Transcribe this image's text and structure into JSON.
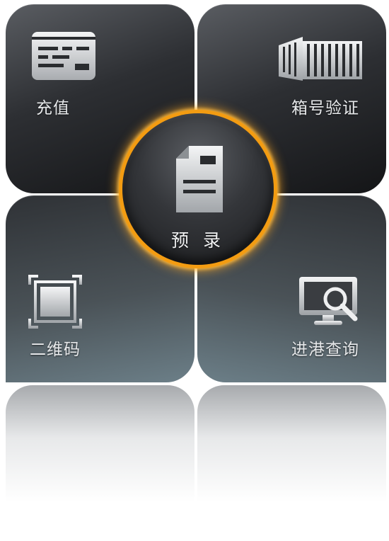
{
  "tiles": {
    "recharge": {
      "label": "充值",
      "icon": "card-icon"
    },
    "container_verify": {
      "label": "箱号验证",
      "icon": "container-icon"
    },
    "qr_code": {
      "label": "二维码",
      "icon": "qr-frame-icon"
    },
    "port_entry_query": {
      "label": "进港查询",
      "icon": "monitor-search-icon"
    }
  },
  "center": {
    "label": "预 录",
    "icon": "document-icon"
  },
  "colors": {
    "accent_ring": "#f39c12",
    "tile_dark": "#1a1b1d",
    "tile_light": "#6c7f88",
    "label_text": "#e6e8ea"
  }
}
